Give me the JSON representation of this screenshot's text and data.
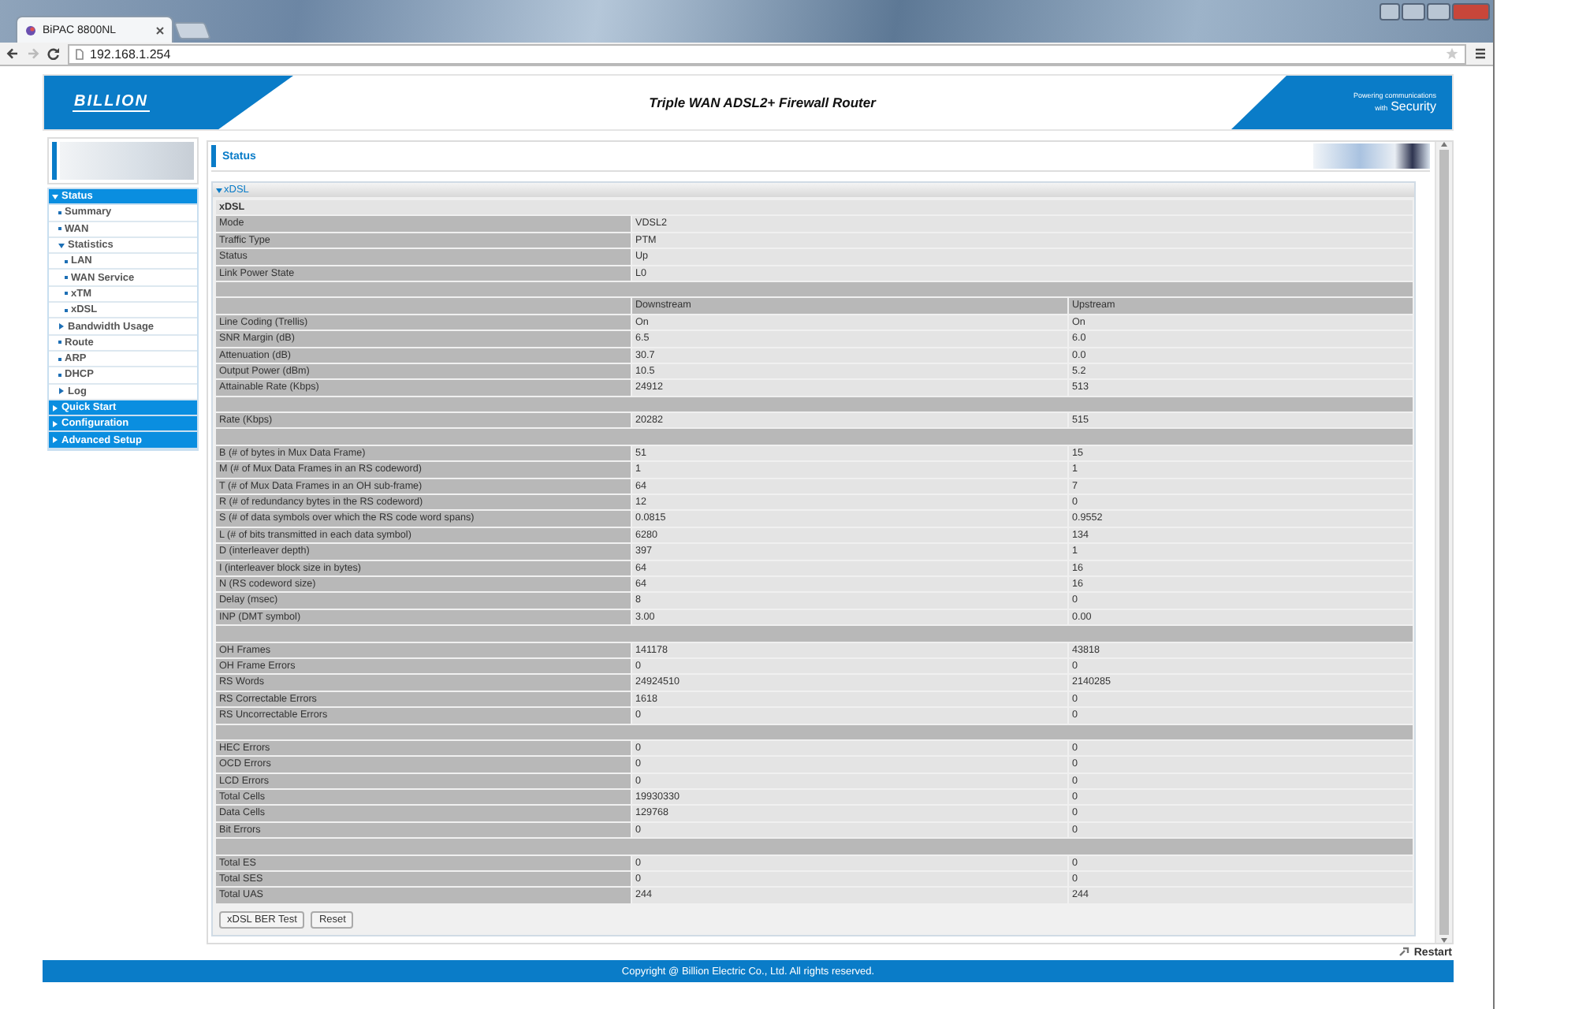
{
  "browser": {
    "tab_title": "BiPAC 8800NL",
    "address": "192.168.1.254"
  },
  "header": {
    "logo": "BILLION",
    "title": "Triple WAN ADSL2+ Firewall Router",
    "tagline_small": "Powering communications",
    "tagline_with": "with",
    "tagline_big": "Security"
  },
  "sidebar": {
    "items": [
      {
        "label": "Status",
        "kind": "folder",
        "expanded": true,
        "children": [
          {
            "label": "Summary",
            "kind": "page"
          },
          {
            "label": "WAN",
            "kind": "page"
          },
          {
            "label": "Statistics",
            "kind": "folder",
            "expanded": true,
            "children": [
              {
                "label": "LAN",
                "kind": "page"
              },
              {
                "label": "WAN Service",
                "kind": "page"
              },
              {
                "label": "xTM",
                "kind": "page"
              },
              {
                "label": "xDSL",
                "kind": "page"
              }
            ]
          },
          {
            "label": "Bandwidth Usage",
            "kind": "folder",
            "expanded": false
          },
          {
            "label": "Route",
            "kind": "page"
          },
          {
            "label": "ARP",
            "kind": "page"
          },
          {
            "label": "DHCP",
            "kind": "page"
          },
          {
            "label": "Log",
            "kind": "folder",
            "expanded": false
          }
        ]
      },
      {
        "label": "Quick Start",
        "kind": "folder",
        "expanded": false
      },
      {
        "label": "Configuration",
        "kind": "folder",
        "expanded": false
      },
      {
        "label": "Advanced Setup",
        "kind": "folder",
        "expanded": false
      }
    ]
  },
  "page_title": "Status",
  "section": {
    "title": "xDSL",
    "expanded": true
  },
  "rows": [
    {
      "kind": "title",
      "label": "xDSL"
    },
    {
      "kind": "single",
      "label": "Mode",
      "value": "VDSL2"
    },
    {
      "kind": "single",
      "label": "Traffic Type",
      "value": "PTM"
    },
    {
      "kind": "single",
      "label": "Status",
      "value": "Up"
    },
    {
      "kind": "single",
      "label": "Link Power State",
      "value": "L0"
    },
    {
      "kind": "separator"
    },
    {
      "kind": "columns",
      "down": "Downstream",
      "up": "Upstream"
    },
    {
      "kind": "dual",
      "label": "Line Coding (Trellis)",
      "down": "On",
      "up": "On"
    },
    {
      "kind": "dual",
      "label": "SNR Margin (dB)",
      "down": "6.5",
      "up": "6.0"
    },
    {
      "kind": "dual",
      "label": "Attenuation (dB)",
      "down": "30.7",
      "up": "0.0"
    },
    {
      "kind": "dual",
      "label": "Output Power (dBm)",
      "down": "10.5",
      "up": "5.2"
    },
    {
      "kind": "dual",
      "label": "Attainable Rate (Kbps)",
      "down": "24912",
      "up": "513"
    },
    {
      "kind": "separator"
    },
    {
      "kind": "dual",
      "label": "Rate (Kbps)",
      "down": "20282",
      "up": "515"
    },
    {
      "kind": "separator"
    },
    {
      "kind": "dual",
      "label": "B (# of bytes in Mux Data Frame)",
      "down": "51",
      "up": "15"
    },
    {
      "kind": "dual",
      "label": "M (# of Mux Data Frames in an RS codeword)",
      "down": "1",
      "up": "1"
    },
    {
      "kind": "dual",
      "label": "T (# of Mux Data Frames in an OH sub-frame)",
      "down": "64",
      "up": "7"
    },
    {
      "kind": "dual",
      "label": "R (# of redundancy bytes in the RS codeword)",
      "down": "12",
      "up": "0"
    },
    {
      "kind": "dual",
      "label": "S (# of data symbols over which the RS code word spans)",
      "down": "0.0815",
      "up": "0.9552"
    },
    {
      "kind": "dual",
      "label": "L (# of bits transmitted in each data symbol)",
      "down": "6280",
      "up": "134"
    },
    {
      "kind": "dual",
      "label": "D (interleaver depth)",
      "down": "397",
      "up": "1"
    },
    {
      "kind": "dual",
      "label": "I (interleaver block size in bytes)",
      "down": "64",
      "up": "16"
    },
    {
      "kind": "dual",
      "label": "N (RS codeword size)",
      "down": "64",
      "up": "16"
    },
    {
      "kind": "dual",
      "label": "Delay (msec)",
      "down": "8",
      "up": "0"
    },
    {
      "kind": "dual",
      "label": "INP (DMT symbol)",
      "down": "3.00",
      "up": "0.00"
    },
    {
      "kind": "separator"
    },
    {
      "kind": "dual",
      "label": "OH Frames",
      "down": "141178",
      "up": "43818"
    },
    {
      "kind": "dual",
      "label": "OH Frame Errors",
      "down": "0",
      "up": "0"
    },
    {
      "kind": "dual",
      "label": "RS Words",
      "down": "24924510",
      "up": "2140285"
    },
    {
      "kind": "dual",
      "label": "RS Correctable Errors",
      "down": "1618",
      "up": "0"
    },
    {
      "kind": "dual",
      "label": "RS Uncorrectable Errors",
      "down": "0",
      "up": "0"
    },
    {
      "kind": "separator"
    },
    {
      "kind": "dual",
      "label": "HEC Errors",
      "down": "0",
      "up": "0"
    },
    {
      "kind": "dual",
      "label": "OCD Errors",
      "down": "0",
      "up": "0"
    },
    {
      "kind": "dual",
      "label": "LCD Errors",
      "down": "0",
      "up": "0"
    },
    {
      "kind": "dual",
      "label": "Total Cells",
      "down": "19930330",
      "up": "0"
    },
    {
      "kind": "dual",
      "label": "Data Cells",
      "down": "129768",
      "up": "0"
    },
    {
      "kind": "dual",
      "label": "Bit Errors",
      "down": "0",
      "up": "0"
    },
    {
      "kind": "separator"
    },
    {
      "kind": "dual",
      "label": "Total ES",
      "down": "0",
      "up": "0"
    },
    {
      "kind": "dual",
      "label": "Total SES",
      "down": "0",
      "up": "0"
    },
    {
      "kind": "dual",
      "label": "Total UAS",
      "down": "244",
      "up": "244"
    }
  ],
  "buttons": [
    "xDSL BER Test",
    "Reset"
  ],
  "restart": "Restart",
  "footer": "Copyright @ Billion Electric Co., Ltd. All rights reserved."
}
